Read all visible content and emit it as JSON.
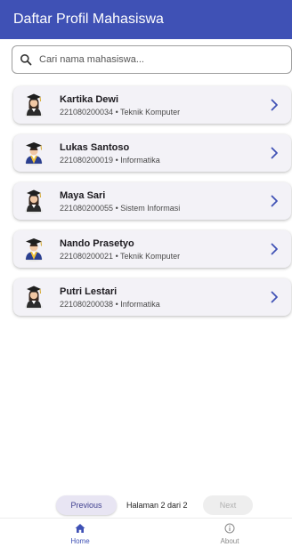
{
  "appbar": {
    "title": "Daftar Profil Mahasiswa",
    "color": "#3f51b5"
  },
  "search": {
    "placeholder": "Cari nama mahasiswa...",
    "icon": "search-icon"
  },
  "students": [
    {
      "name": "Kartika Dewi",
      "meta": "221080200034 • Teknik Komputer",
      "avatar": "female-graduate-avatar"
    },
    {
      "name": "Lukas Santoso",
      "meta": "221080200019 • Informatika",
      "avatar": "male-graduate-avatar"
    },
    {
      "name": "Maya Sari",
      "meta": "221080200055 • Sistem Informasi",
      "avatar": "female-graduate-avatar"
    },
    {
      "name": "Nando Prasetyo",
      "meta": "221080200021 • Teknik Komputer",
      "avatar": "male-graduate-avatar"
    },
    {
      "name": "Putri Lestari",
      "meta": "221080200038 • Informatika",
      "avatar": "female-graduate-avatar"
    }
  ],
  "pagination": {
    "previous_label": "Previous",
    "page_text": "Halaman 2 dari 2",
    "next_label": "Next"
  },
  "bottom_nav": [
    {
      "label": "Home",
      "icon": "home-icon",
      "active": true
    },
    {
      "label": "About",
      "icon": "info-icon",
      "active": false
    }
  ]
}
